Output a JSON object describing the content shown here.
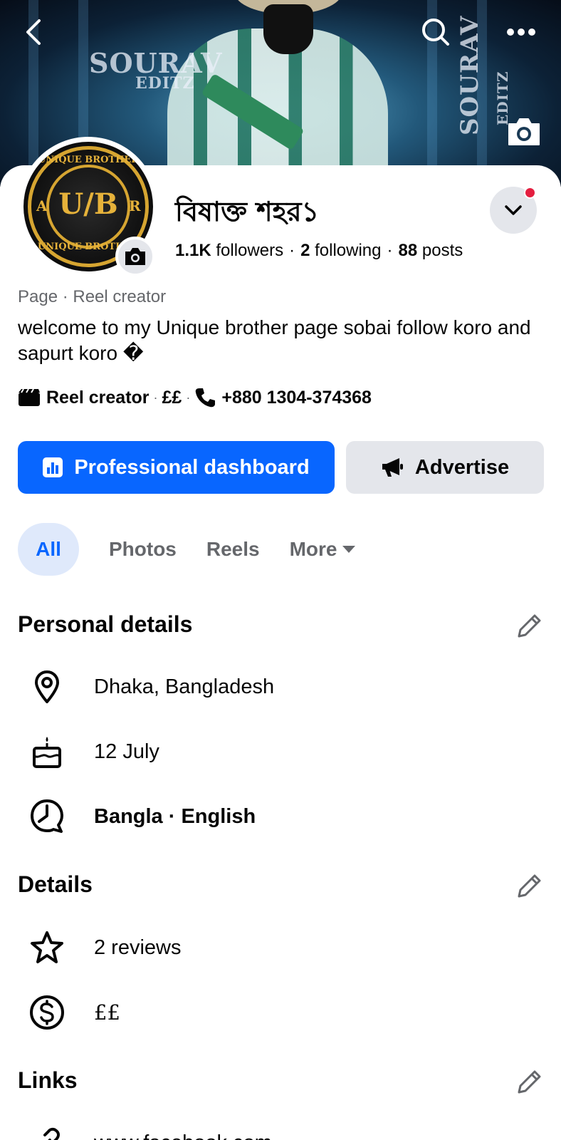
{
  "header": {
    "back_icon": "chevron-left-icon",
    "search_icon": "search-icon",
    "more_icon": "more-horizontal-icon",
    "cover_camera_icon": "camera-icon",
    "cover_watermark_text": "SOURAV",
    "cover_watermark_sub": "EDITZ"
  },
  "profile": {
    "name": "বিষাক্ত শহর১",
    "avatar_text_top": "UNIQUE BROTHER",
    "avatar_monogram": "U/B",
    "avatar_left": "A",
    "avatar_right": "R",
    "avatar_text_bottom": "UNIQUE BROTHER",
    "followers_count": "1.1K",
    "followers_label": "followers",
    "following_count": "2",
    "following_label": "following",
    "posts_count": "88",
    "posts_label": "posts",
    "separator": "·",
    "category": "Page · Reel creator",
    "bio": "welcome to my Unique brother page sobai follow koro and sapurt koro �",
    "info": {
      "creator_label": "Reel creator",
      "price": "££",
      "phone": "+880 1304-374368"
    },
    "dropdown_notification": true
  },
  "actions": {
    "primary_label": "Professional dashboard",
    "secondary_label": "Advertise"
  },
  "tabs": [
    {
      "label": "All",
      "active": true
    },
    {
      "label": "Photos",
      "active": false
    },
    {
      "label": "Reels",
      "active": false
    },
    {
      "label": "More",
      "active": false
    }
  ],
  "personal_details": {
    "title": "Personal details",
    "location": "Dhaka, Bangladesh",
    "birthday": "12 July",
    "languages": "Bangla · English"
  },
  "details": {
    "title": "Details",
    "reviews": "2 reviews",
    "price_range": "££"
  },
  "links": {
    "title": "Links",
    "first_link": "www.facebook.com"
  },
  "colors": {
    "primary": "#0866ff",
    "secondary_bg": "#e4e6eb",
    "muted_text": "#65676b",
    "badge": "#e41e3f"
  }
}
